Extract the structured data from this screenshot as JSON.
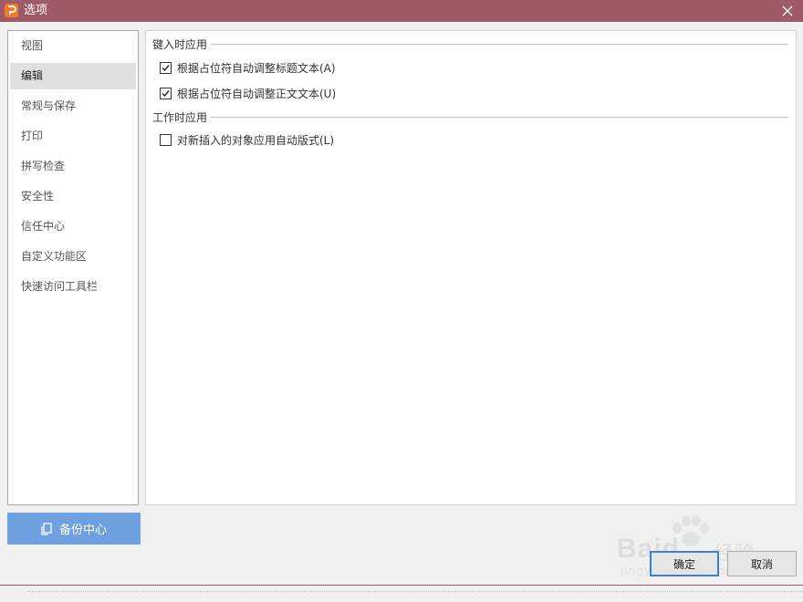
{
  "window": {
    "title": "选项"
  },
  "sidebar": {
    "items": [
      {
        "label": "视图",
        "active": false
      },
      {
        "label": "编辑",
        "active": true
      },
      {
        "label": "常规与保存",
        "active": false
      },
      {
        "label": "打印",
        "active": false
      },
      {
        "label": "拼写检查",
        "active": false
      },
      {
        "label": "安全性",
        "active": false
      },
      {
        "label": "信任中心",
        "active": false
      },
      {
        "label": "自定义功能区",
        "active": false
      },
      {
        "label": "快速访问工具栏",
        "active": false
      }
    ],
    "backup_label": "备份中心"
  },
  "panel": {
    "section_typing": "键入时应用",
    "option_title": {
      "label": "根据占位符自动调整标题文本(A)",
      "checked": true
    },
    "option_body": {
      "label": "根据占位符自动调整正文文本(U)",
      "checked": true
    },
    "section_working": "工作时应用",
    "option_autolayout": {
      "label": "对新插入的对象应用自动版式(L)",
      "checked": false
    }
  },
  "buttons": {
    "ok": "确定",
    "cancel": "取消"
  },
  "watermark": {
    "main": "Baid",
    "cn": "经验",
    "sub": "jingyan.baidu.com"
  },
  "colors": {
    "titlebar": "#9e5b67",
    "accent": "#6fa0e0",
    "app_icon": "#ef7b2b",
    "active_item": "#e0e0e0"
  }
}
